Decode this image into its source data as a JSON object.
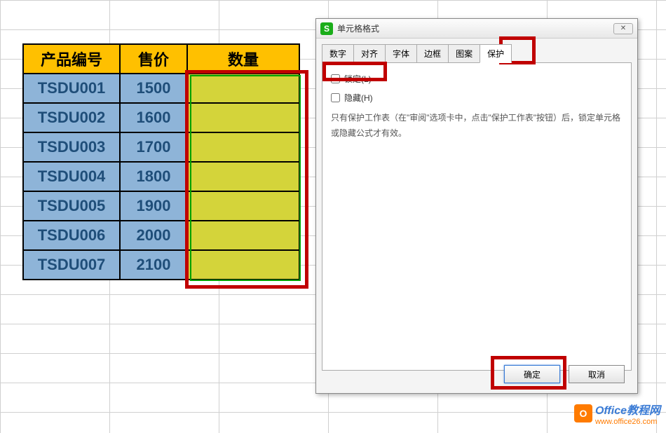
{
  "table": {
    "headers": [
      "产品编号",
      "售价",
      "数量"
    ],
    "rows": [
      {
        "id": "TSDU001",
        "price": "1500",
        "qty": ""
      },
      {
        "id": "TSDU002",
        "price": "1600",
        "qty": ""
      },
      {
        "id": "TSDU003",
        "price": "1700",
        "qty": ""
      },
      {
        "id": "TSDU004",
        "price": "1800",
        "qty": ""
      },
      {
        "id": "TSDU005",
        "price": "1900",
        "qty": ""
      },
      {
        "id": "TSDU006",
        "price": "2000",
        "qty": ""
      },
      {
        "id": "TSDU007",
        "price": "2100",
        "qty": ""
      }
    ]
  },
  "dialog": {
    "title": "单元格格式",
    "tabs": [
      "数字",
      "对齐",
      "字体",
      "边框",
      "图案",
      "保护"
    ],
    "active_tab": "保护",
    "protect": {
      "lock_label": "锁定(L)",
      "hide_label": "隐藏(H)",
      "desc": "只有保护工作表（在\"审阅\"选项卡中，点击\"保护工作表\"按钮）后，锁定单元格或隐藏公式才有效。"
    },
    "buttons": {
      "ok": "确定",
      "cancel": "取消"
    }
  },
  "watermark": {
    "brand": "Office教程网",
    "url": "www.office26.com",
    "icon": "O"
  }
}
